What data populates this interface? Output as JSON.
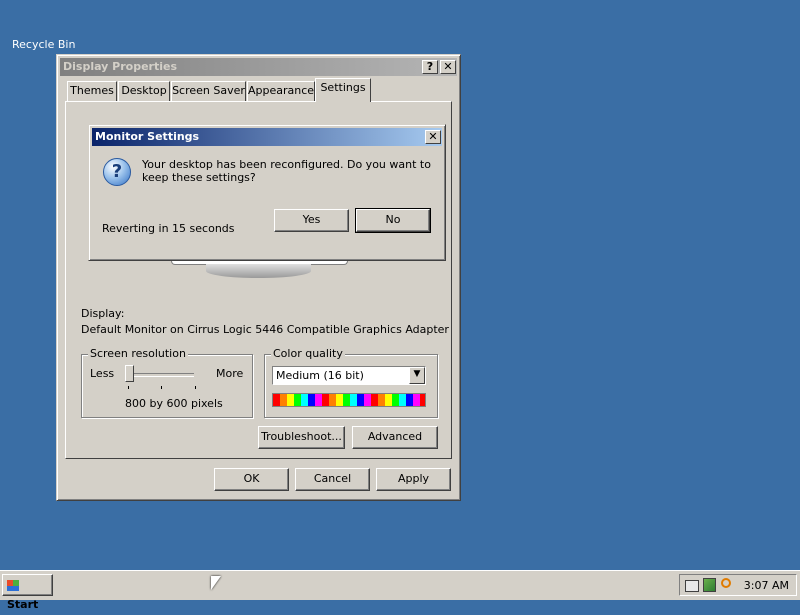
{
  "desktop": {
    "recycle_bin_label": "Recycle Bin"
  },
  "display_properties": {
    "title": "Display Properties",
    "help_label": "?",
    "close_label": "✕",
    "tabs": [
      {
        "label": "Themes"
      },
      {
        "label": "Desktop"
      },
      {
        "label": "Screen Saver"
      },
      {
        "label": "Appearance"
      },
      {
        "label": "Settings"
      }
    ],
    "selected_tab": "Settings",
    "display_label": "Display:",
    "display_value": "Default Monitor on Cirrus Logic 5446 Compatible Graphics Adapter",
    "resolution": {
      "legend": "Screen resolution",
      "less_label": "Less",
      "more_label": "More",
      "value_text": "800 by 600 pixels"
    },
    "color_quality": {
      "legend": "Color quality",
      "selected": "Medium (16 bit)"
    },
    "troubleshoot_label": "Troubleshoot...",
    "advanced_label": "Advanced",
    "ok_label": "OK",
    "cancel_label": "Cancel",
    "apply_label": "Apply"
  },
  "monitor_dialog": {
    "title": "Monitor Settings",
    "close_label": "✕",
    "message": "Your desktop has been reconfigured.  Do you want to keep these settings?",
    "countdown": "Reverting in 15 seconds",
    "yes_label": "Yes",
    "no_label": "No"
  },
  "taskbar": {
    "start_label": "Start",
    "clock": "3:07 AM"
  }
}
